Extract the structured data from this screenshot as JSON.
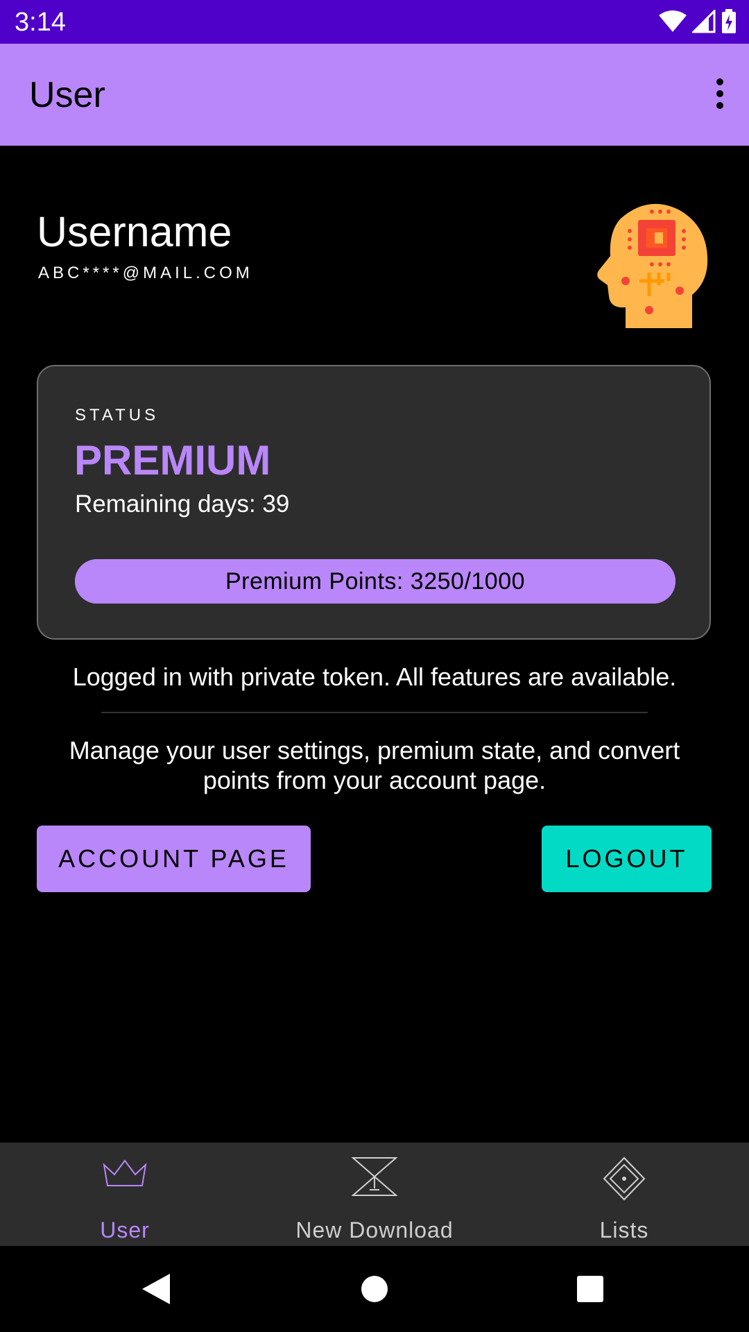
{
  "status_bar": {
    "time": "3:14"
  },
  "app_bar": {
    "title": "User",
    "overflow_icon": "more-vert-icon"
  },
  "profile": {
    "username": "Username",
    "email": "ABC****@MAIL.COM",
    "avatar_icon": "ai-head-icon"
  },
  "status_card": {
    "label": "STATUS",
    "value": "PREMIUM",
    "remaining_days": "Remaining days: 39",
    "points_text": "Premium Points: 3250/1000",
    "points_fraction": 1.0
  },
  "token_message": "Logged in with private token. All features are available.",
  "manage_message": "Manage your user settings, premium state, and convert points from your account page.",
  "buttons": {
    "account_page": "ACCOUNT PAGE",
    "logout": "LOGOUT"
  },
  "bottom_nav": {
    "items": [
      {
        "label": "User",
        "icon": "crown-icon",
        "active": true
      },
      {
        "label": "New Download",
        "icon": "hourglass-icon",
        "active": false
      },
      {
        "label": "Lists",
        "icon": "diamond-icon",
        "active": false
      }
    ]
  },
  "colors": {
    "status_bar": "#4f00c9",
    "accent": "#b987f9",
    "teal": "#03dac6",
    "card": "#2d2d2d",
    "nav_inactive": "#cfcfcf"
  }
}
